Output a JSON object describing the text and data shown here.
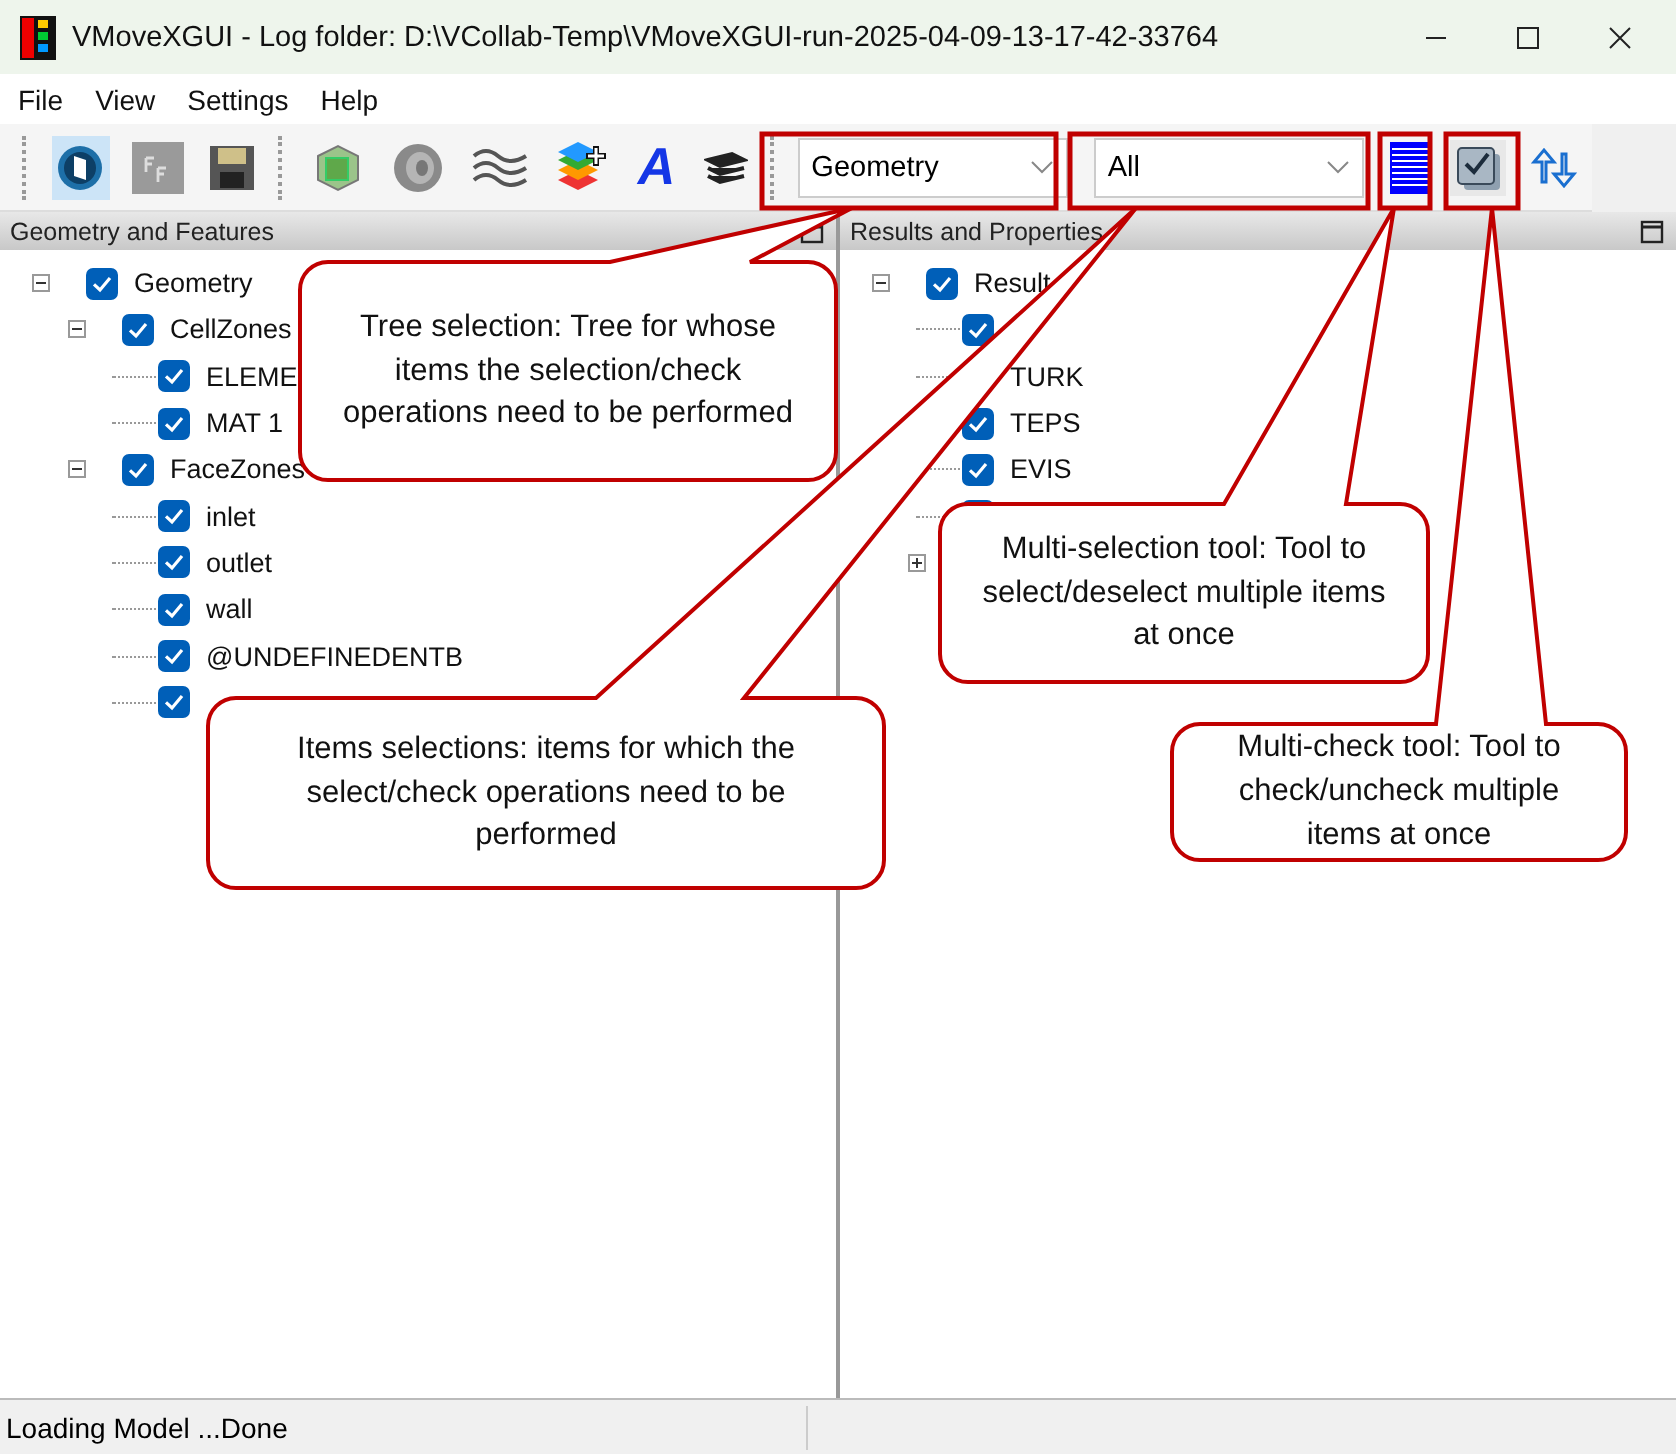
{
  "window": {
    "title": "VMoveXGUI - Log folder: D:\\VCollab-Temp\\VMoveXGUI-run-2025-04-09-13-17-42-33764"
  },
  "menu": [
    "File",
    "View",
    "Settings",
    "Help"
  ],
  "toolbar": {
    "text_tool": "A",
    "tree_select": "Geometry",
    "items_select": "All"
  },
  "panels": [
    {
      "title": "Geometry and Features",
      "tree": [
        {
          "label": "Geometry",
          "checked": true,
          "expanded": true,
          "children": [
            {
              "label": "CellZones",
              "checked": true,
              "expanded": true,
              "children": [
                {
                  "label": "ELEME",
                  "checked": true
                },
                {
                  "label": "MAT 1",
                  "checked": true
                }
              ]
            },
            {
              "label": "FaceZones",
              "checked": true,
              "expanded": true,
              "children": [
                {
                  "label": "inlet",
                  "checked": true
                },
                {
                  "label": "outlet",
                  "checked": true
                },
                {
                  "label": "wall",
                  "checked": true
                },
                {
                  "label": "@UNDEFINEDENTB",
                  "checked": true
                },
                {
                  "checked": true
                }
              ]
            }
          ]
        }
      ]
    },
    {
      "title": "Results and Properties",
      "tree": [
        {
          "label": "Result",
          "checked": true,
          "expanded": true,
          "children": [
            {
              "checked": true
            },
            {
              "label": "TURK"
            },
            {
              "label": "TEPS",
              "checked": true
            },
            {
              "label": "EVIS",
              "checked": true
            },
            {
              "checked": true
            },
            {
              "expanded": false
            }
          ]
        }
      ]
    }
  ],
  "callouts": [
    "Tree selection: Tree for whose items the selection/check operations need to be performed",
    "Items selections: items for which the select/check operations need to be performed",
    "Multi-selection tool: Tool to select/deselect multiple items at once",
    "Multi-check tool: Tool to check/uncheck multiple items at once"
  ],
  "status_bar": "Loading Model ...Done"
}
